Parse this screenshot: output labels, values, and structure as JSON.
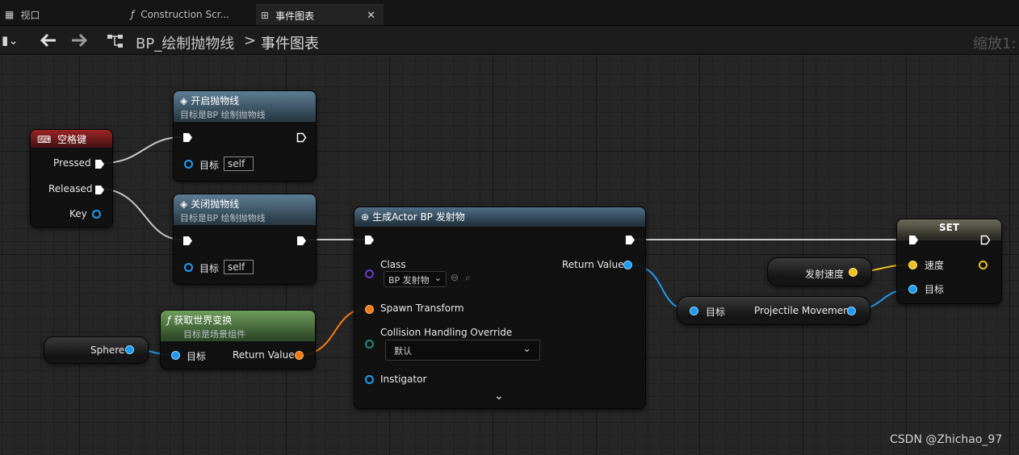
{
  "tabs": [
    {
      "label": "视口",
      "icon": "viewport-icon"
    },
    {
      "label": "Construction Scr...",
      "icon": "function-icon"
    },
    {
      "label": "事件图表",
      "icon": "graph-icon",
      "active": true
    }
  ],
  "toolbar": {
    "breadcrumb_blueprint": "BP_绘制抛物线",
    "breadcrumb_separator": ">",
    "breadcrumb_graph": "事件图表",
    "zoom": "缩放1:"
  },
  "nodes": {
    "space_key": {
      "title": "空格键",
      "pins": {
        "pressed": "Pressed",
        "released": "Released",
        "key": "Key"
      }
    },
    "enable_parabola": {
      "title": "开启抛物线",
      "subtitle": "目标是BP 绘制抛物线",
      "target_label": "目标",
      "target_value": "self"
    },
    "disable_parabola": {
      "title": "关闭抛物线",
      "subtitle": "目标是BP 绘制抛物线",
      "target_label": "目标",
      "target_value": "self"
    },
    "get_world_transform": {
      "title": "获取世界变换",
      "subtitle": "目标是场景组件",
      "target_label": "目标",
      "return_label": "Return Value"
    },
    "sphere_var": {
      "label": "Sphere"
    },
    "spawn_actor": {
      "title": "生成Actor BP 发射物",
      "class_label": "Class",
      "class_value": "BP 发射物",
      "return_label": "Return Value",
      "spawn_transform_label": "Spawn Transform",
      "collision_label": "Collision Handling Override",
      "collision_value": "默认",
      "instigator_label": "Instigator"
    },
    "projectile_movement": {
      "target_label": "目标",
      "label": "Projectile Movement"
    },
    "launch_speed_var": {
      "label": "发射速度"
    },
    "set_node": {
      "title": "SET",
      "speed_label": "速度",
      "target_label": "目标"
    }
  },
  "watermark": "CSDN @Zhichao_97"
}
